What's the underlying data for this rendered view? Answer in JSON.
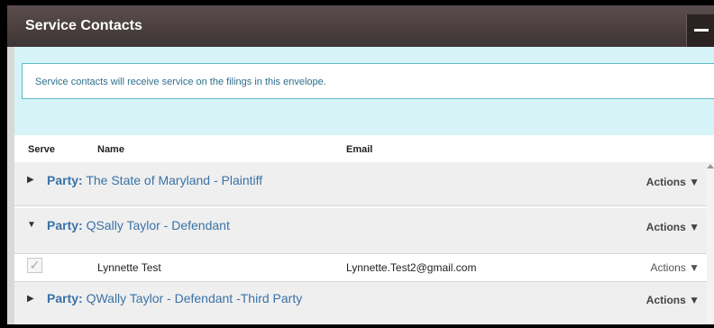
{
  "window": {
    "title": "Service Contacts"
  },
  "info_text": "Service contacts will receive service on the filings in this envelope.",
  "columns": {
    "serve": "Serve",
    "name": "Name",
    "email": "Email"
  },
  "parties": [
    {
      "prefix": "Party:",
      "name": "The State of Maryland - Plaintiff",
      "expanded": false,
      "toggle": "▶",
      "actions_label": "Actions ▼"
    },
    {
      "prefix": "Party:",
      "name": "QSally Taylor - Defendant",
      "expanded": true,
      "toggle": "▼",
      "actions_label": "Actions ▼"
    },
    {
      "prefix": "Party:",
      "name": "QWally Taylor - Defendant -Third Party",
      "expanded": false,
      "toggle": "▶",
      "actions_label": "Actions ▼"
    }
  ],
  "contact": {
    "checkmark": "✓",
    "name": "Lynnette Test",
    "email": "Lynnette.Test2@gmail.com",
    "actions_label": "Actions ▼"
  },
  "colors": {
    "titlebar": "#4a3e3e",
    "link": "#3a72a8",
    "info_border": "#5fb8c6"
  }
}
